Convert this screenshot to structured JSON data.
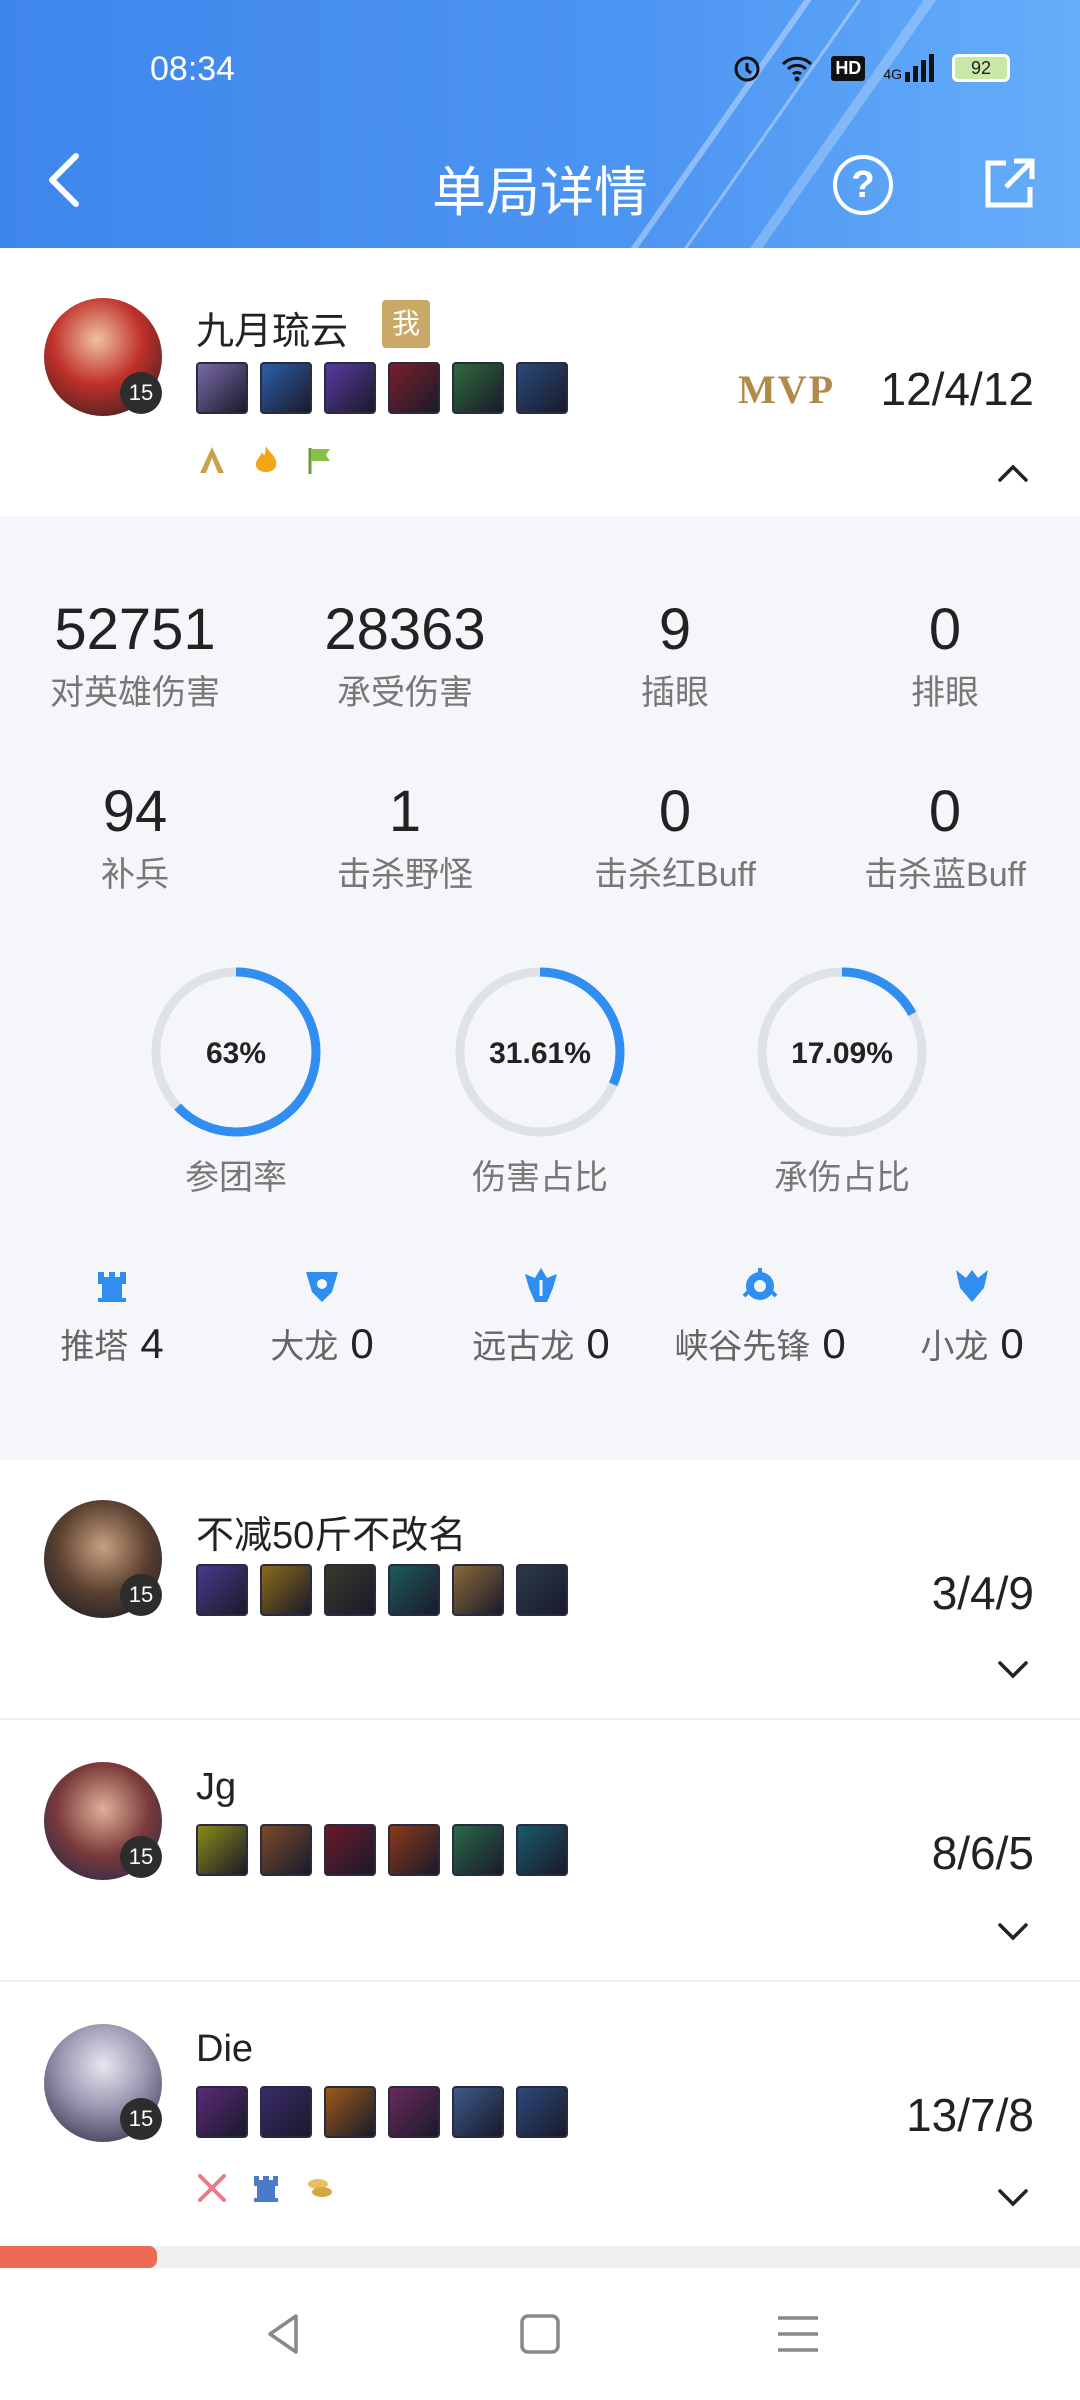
{
  "status_bar": {
    "time": "08:34",
    "battery": "92",
    "network": "4G",
    "hd": "HD"
  },
  "header": {
    "title": "单局详情",
    "help_symbol": "?"
  },
  "colors": {
    "header_blue": "#4a8ff0",
    "accent_ring": "#2f8ef0",
    "progress_bar": "#ed6a55",
    "mvp_gold": "#b08a4a"
  },
  "players": [
    {
      "name": "九月琉云",
      "me_badge": "我",
      "level": "15",
      "mvp": "MVP",
      "kda": "12/4/12",
      "item_colors": [
        "#7a6aa8",
        "#2e5fa8",
        "#5a3aa0",
        "#7a1f2a",
        "#2f6a3a",
        "#2a4a7a"
      ],
      "badge_icons": [
        "gold-a-badge-icon",
        "flame-icon",
        "green-flag-icon"
      ],
      "expanded": true
    },
    {
      "name": "不减50斤不改名",
      "level": "15",
      "kda": "3/4/9",
      "item_colors": [
        "#4a3a8a",
        "#8a6a1a",
        "#3a3a2a",
        "#1e5a5a",
        "#8a6a3a",
        "#2a3a4a"
      ],
      "expanded": false
    },
    {
      "name": "Jg",
      "level": "15",
      "kda": "8/6/5",
      "item_colors": [
        "#8a8a1a",
        "#7a4a2a",
        "#6a1a2a",
        "#8a3a1a",
        "#2a6a4a",
        "#1a5a6a"
      ],
      "expanded": false
    },
    {
      "name": "Die",
      "level": "15",
      "kda": "13/7/8",
      "item_colors": [
        "#5a2a7a",
        "#3a2a6a",
        "#9a5a1a",
        "#6a2a5a",
        "#3a5a8a",
        "#2a4a7a"
      ],
      "badge_icons": [
        "crossed-swords-icon",
        "tower-icon",
        "coins-icon"
      ],
      "expanded": false
    }
  ],
  "stats": {
    "row1": [
      {
        "value": "52751",
        "label": "对英雄伤害"
      },
      {
        "value": "28363",
        "label": "承受伤害"
      },
      {
        "value": "9",
        "label": "插眼"
      },
      {
        "value": "0",
        "label": "排眼"
      }
    ],
    "row2": [
      {
        "value": "94",
        "label": "补兵"
      },
      {
        "value": "1",
        "label": "击杀野怪"
      },
      {
        "value": "0",
        "label": "击杀红Buff"
      },
      {
        "value": "0",
        "label": "击杀蓝Buff"
      }
    ],
    "rings": [
      {
        "text": "63%",
        "fraction": 0.63,
        "label": "参团率"
      },
      {
        "text": "31.61%",
        "fraction": 0.3161,
        "label": "伤害占比"
      },
      {
        "text": "17.09%",
        "fraction": 0.1709,
        "label": "承伤占比"
      }
    ],
    "objectives": [
      {
        "label": "推塔",
        "value": "4",
        "icon": "tower-icon"
      },
      {
        "label": "大龙",
        "value": "0",
        "icon": "baron-icon"
      },
      {
        "label": "远古龙",
        "value": "0",
        "icon": "elder-dragon-icon"
      },
      {
        "label": "峡谷先锋",
        "value": "0",
        "icon": "rift-herald-icon"
      },
      {
        "label": "小龙",
        "value": "0",
        "icon": "dragon-icon"
      }
    ]
  },
  "progress": {
    "fraction": 0.145
  }
}
